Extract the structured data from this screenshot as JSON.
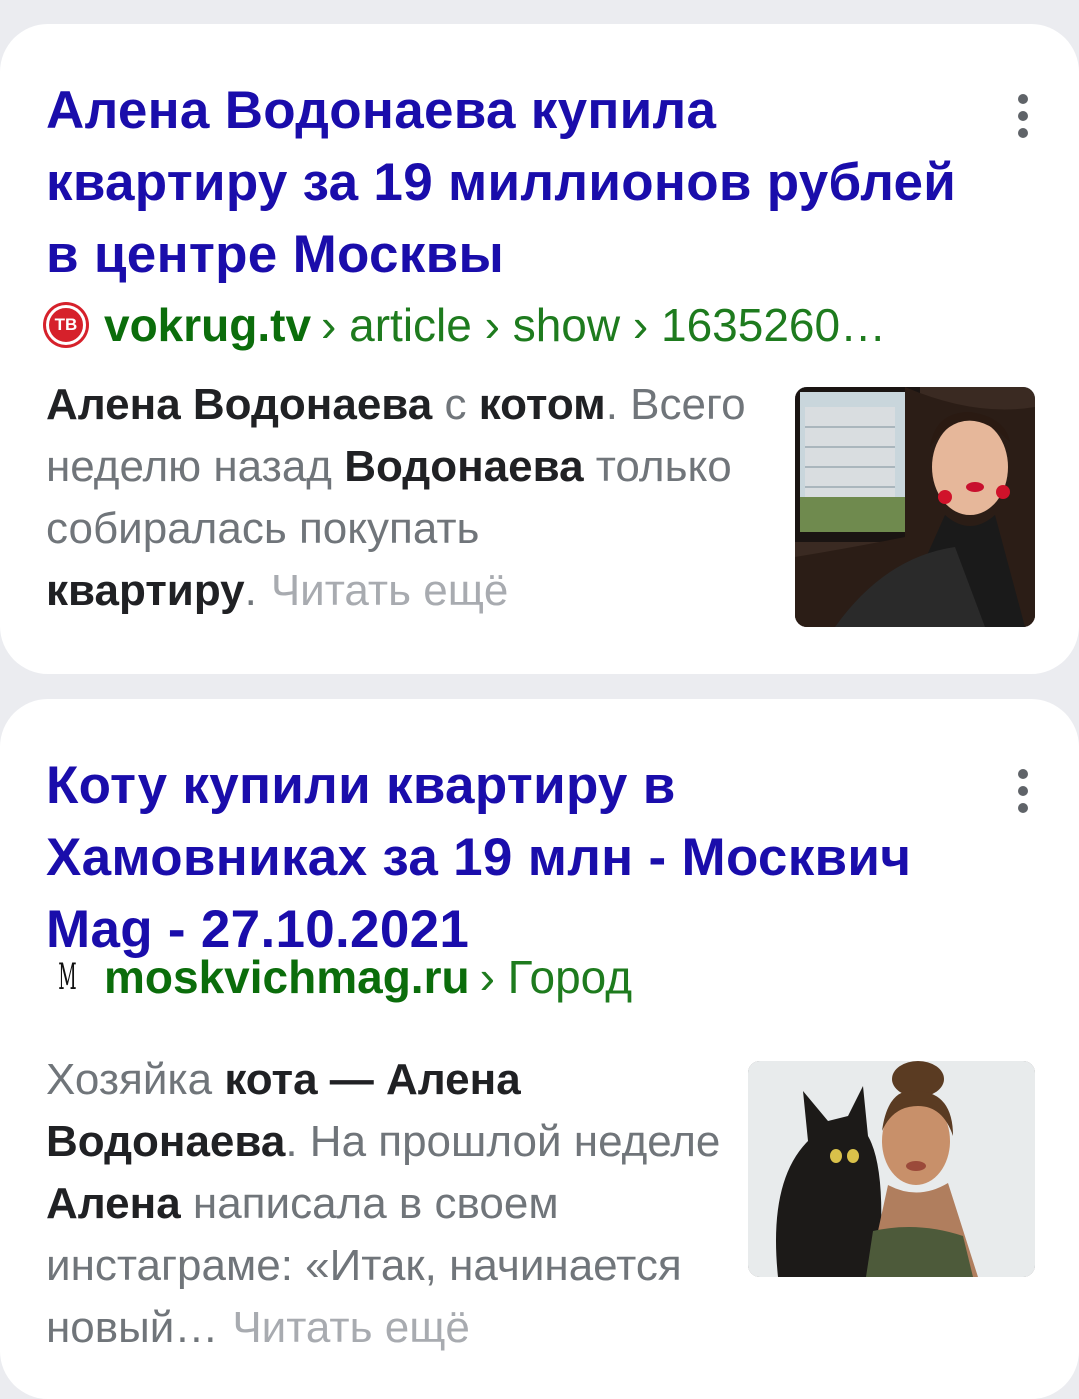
{
  "results": [
    {
      "title": "Алена Водонаева купила квартиру за 19 миллионов рублей в центре Москвы",
      "favicon_text": "ТВ",
      "domain": "vokrug.tv",
      "path": "› article › show › 1635260…",
      "snippet": {
        "p1": "Алена Водонаева",
        "p2": " с ",
        "p3": "котом",
        "p4": ". Всего неделю назад ",
        "p5": "Водонаева",
        "p6": " только собиралась покупать ",
        "p7": "квартиру",
        "p8": "."
      },
      "read_more": "Читать ещё",
      "thumbnail": "photo-woman-in-car"
    },
    {
      "title": "Коту купили квартиру в Хамовниках за 19 млн - Москвич Mag - 27.10.2021",
      "favicon_text": "M",
      "domain": "moskvichmag.ru",
      "path": "› Город",
      "snippet": {
        "p1": "Хозяйка ",
        "p2": "кота — Алена Водонаева",
        "p3": ". На прошлой неделе ",
        "p4": "Алена",
        "p5": " написала в своем инстаграме: «Итак, начинается новый…"
      },
      "read_more": "Читать ещё",
      "thumbnail": "photo-woman-with-cat"
    }
  ],
  "icons": {
    "menu": "more-vert-icon"
  },
  "colors": {
    "background": "#ebecf0",
    "card": "#ffffff",
    "title": "#1a0dab",
    "url": "#0b6d0b",
    "snippet": "#70757a",
    "snippet_bold": "#202124",
    "read_more": "#a8abb0"
  }
}
